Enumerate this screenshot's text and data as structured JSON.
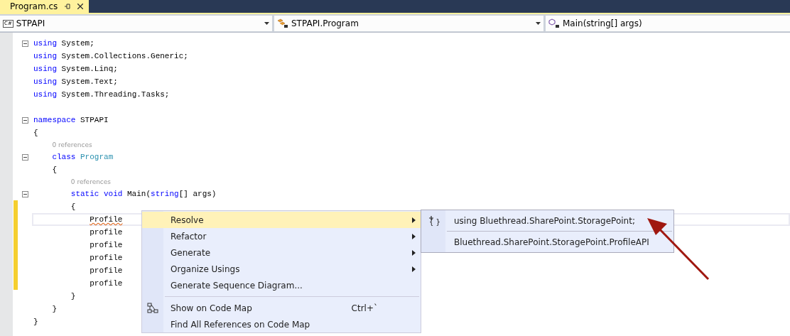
{
  "tab": {
    "title": "Program.cs",
    "selected": true
  },
  "nav_bar": [
    {
      "kind": "project",
      "icon_text": "C#",
      "text": "STPAPI",
      "has_dropdown": true
    },
    {
      "kind": "class",
      "text": "STPAPI.Program",
      "has_dropdown": true
    },
    {
      "kind": "method",
      "text": "Main(string[] args)",
      "has_dropdown": false
    }
  ],
  "code_lines": [
    {
      "kind": "code",
      "fold": true,
      "changed": false,
      "current": false,
      "segments": [
        {
          "kind": "keyword",
          "text": "using"
        },
        {
          "kind": "plain",
          "text": " System;"
        }
      ]
    },
    {
      "kind": "code",
      "fold": false,
      "changed": false,
      "current": false,
      "segments": [
        {
          "kind": "keyword",
          "text": "using"
        },
        {
          "kind": "plain",
          "text": " System.Collections.Generic;"
        }
      ]
    },
    {
      "kind": "code",
      "fold": false,
      "changed": false,
      "current": false,
      "segments": [
        {
          "kind": "keyword",
          "text": "using"
        },
        {
          "kind": "plain",
          "text": " System.Linq;"
        }
      ]
    },
    {
      "kind": "code",
      "fold": false,
      "changed": false,
      "current": false,
      "segments": [
        {
          "kind": "keyword",
          "text": "using"
        },
        {
          "kind": "plain",
          "text": " System.Text;"
        }
      ]
    },
    {
      "kind": "code",
      "fold": false,
      "changed": false,
      "current": false,
      "segments": [
        {
          "kind": "keyword",
          "text": "using"
        },
        {
          "kind": "plain",
          "text": " System.Threading.Tasks;"
        }
      ]
    },
    {
      "kind": "blank"
    },
    {
      "kind": "code",
      "fold": true,
      "changed": false,
      "current": false,
      "segments": [
        {
          "kind": "keyword",
          "text": "namespace"
        },
        {
          "kind": "plain",
          "text": " STPAPI"
        }
      ]
    },
    {
      "kind": "code",
      "fold": false,
      "changed": false,
      "current": false,
      "segments": [
        {
          "kind": "plain",
          "text": "{"
        }
      ]
    },
    {
      "kind": "lens",
      "text": "0 references"
    },
    {
      "kind": "code",
      "fold": true,
      "changed": false,
      "current": false,
      "segments": [
        {
          "kind": "keyword",
          "text": "    class"
        },
        {
          "kind": "type",
          "text": " Program"
        }
      ]
    },
    {
      "kind": "code",
      "fold": false,
      "changed": false,
      "current": false,
      "segments": [
        {
          "kind": "plain",
          "text": "    {"
        }
      ]
    },
    {
      "kind": "lens",
      "text": "0 references"
    },
    {
      "kind": "code",
      "fold": true,
      "changed": false,
      "current": false,
      "segments": [
        {
          "kind": "keyword",
          "text": "        static void"
        },
        {
          "kind": "plain",
          "text": " Main("
        },
        {
          "kind": "keyword",
          "text": "string"
        },
        {
          "kind": "plain",
          "text": "[] args)"
        }
      ]
    },
    {
      "kind": "code",
      "fold": false,
      "changed": true,
      "current": false,
      "segments": [
        {
          "kind": "plain",
          "text": "        {"
        }
      ]
    },
    {
      "kind": "code",
      "fold": false,
      "changed": true,
      "current": true,
      "segments": [
        {
          "kind": "error",
          "text": "            Profile"
        }
      ]
    },
    {
      "kind": "code",
      "fold": false,
      "changed": true,
      "current": false,
      "segments": [
        {
          "kind": "plain",
          "text": "            profile"
        }
      ]
    },
    {
      "kind": "code",
      "fold": false,
      "changed": true,
      "current": false,
      "segments": [
        {
          "kind": "plain",
          "text": "            profile"
        }
      ]
    },
    {
      "kind": "code",
      "fold": false,
      "changed": true,
      "current": false,
      "segments": [
        {
          "kind": "plain",
          "text": "            profile"
        }
      ]
    },
    {
      "kind": "code",
      "fold": false,
      "changed": true,
      "current": false,
      "segments": [
        {
          "kind": "plain",
          "text": "            profile"
        }
      ]
    },
    {
      "kind": "code",
      "fold": false,
      "changed": true,
      "current": false,
      "segments": [
        {
          "kind": "plain",
          "text": "            profile"
        }
      ]
    },
    {
      "kind": "code",
      "fold": false,
      "changed": false,
      "current": false,
      "segments": [
        {
          "kind": "plain",
          "text": "        }"
        }
      ]
    },
    {
      "kind": "code",
      "fold": false,
      "changed": false,
      "current": false,
      "segments": [
        {
          "kind": "plain",
          "text": "    }"
        }
      ]
    },
    {
      "kind": "code",
      "fold": false,
      "changed": false,
      "current": false,
      "segments": [
        {
          "kind": "plain",
          "text": "}"
        }
      ]
    }
  ],
  "context_menu": [
    {
      "kind": "item",
      "label": "Resolve",
      "has_submenu": true,
      "selected": true
    },
    {
      "kind": "item",
      "label": "Refactor",
      "has_submenu": true,
      "selected": false
    },
    {
      "kind": "item",
      "label": "Generate",
      "has_submenu": true,
      "selected": false
    },
    {
      "kind": "item",
      "label": "Organize Usings",
      "has_submenu": true,
      "selected": false
    },
    {
      "kind": "item",
      "label": "Generate Sequence Diagram...",
      "has_submenu": false,
      "selected": false
    },
    {
      "kind": "separator"
    },
    {
      "kind": "map_item",
      "label": "Show on Code Map",
      "shortcut": "Ctrl+`",
      "has_submenu": false,
      "selected": false
    },
    {
      "kind": "item",
      "label": "Find All References on Code Map",
      "has_submenu": false,
      "selected": false
    }
  ],
  "submenu": [
    {
      "kind": "using_item",
      "icon_text": "{ }",
      "label": "using Bluethread.SharePoint.StoragePoint;",
      "selected": false
    },
    {
      "kind": "separator"
    },
    {
      "kind": "item",
      "label": "Bluethread.SharePoint.StoragePoint.ProfileAPI",
      "selected": false
    }
  ]
}
